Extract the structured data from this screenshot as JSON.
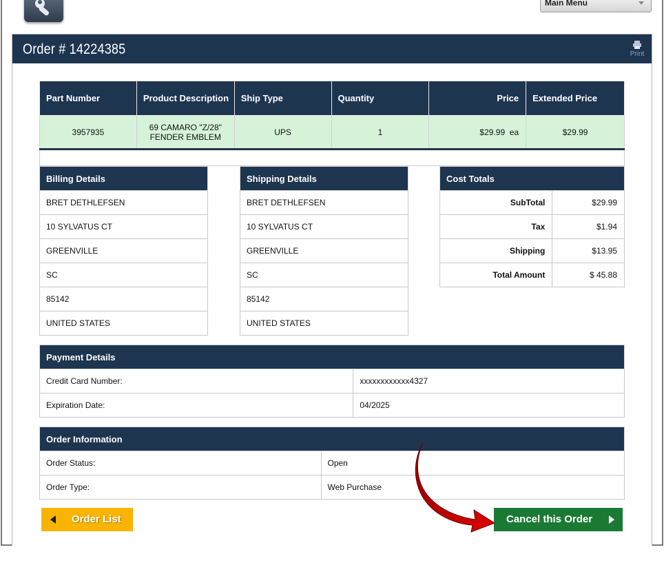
{
  "header": {
    "main_menu_label": "Main Menu",
    "order_title": "Order # 14224385",
    "print_label": "Print"
  },
  "products": {
    "columns": [
      "Part Number",
      "Product Description",
      "Ship Type",
      "Quantity",
      "Price",
      "Extended Price"
    ],
    "rows": [
      {
        "part_number": "3957935",
        "description": "69 CAMARO \"Z/28\" FENDER EMBLEM",
        "ship_type": "UPS",
        "quantity": "1",
        "price": "$29.99  ea",
        "extended_price": "$29.99"
      }
    ]
  },
  "billing": {
    "title": "Billing Details",
    "lines": [
      "BRET DETHLEFSEN",
      "10 SYLVATUS CT",
      "GREENVILLE",
      "SC",
      "85142",
      "UNITED STATES"
    ]
  },
  "shipping": {
    "title": "Shipping Details",
    "lines": [
      "BRET DETHLEFSEN",
      "10 SYLVATUS CT",
      "GREENVILLE",
      "SC",
      "85142",
      "UNITED STATES"
    ]
  },
  "totals": {
    "title": "Cost Totals",
    "rows": [
      {
        "label": "SubTotal",
        "value": "$29.99"
      },
      {
        "label": "Tax",
        "value": "$1.94"
      },
      {
        "label": "Shipping",
        "value": "$13.95"
      },
      {
        "label": "Total Amount",
        "value": "$ 45.88"
      }
    ]
  },
  "payment": {
    "title": "Payment Details",
    "rows": [
      {
        "label": "Credit Card Number:",
        "value": "xxxxxxxxxxxx4327"
      },
      {
        "label": "Expiration Date:",
        "value": "04/2025"
      }
    ]
  },
  "order_info": {
    "title": "Order Information",
    "rows": [
      {
        "label": "Order Status:",
        "value": "Open"
      },
      {
        "label": "Order Type:",
        "value": "Web Purchase"
      }
    ]
  },
  "buttons": {
    "order_list_label": "Order List",
    "cancel_label": "Cancel this Order"
  },
  "colors": {
    "header_navy": "#1e3550",
    "row_green": "#d6f3d9",
    "order_list_yellow": "#f8b400",
    "cancel_green": "#1a7a34",
    "annotation_red": "#c40000"
  }
}
